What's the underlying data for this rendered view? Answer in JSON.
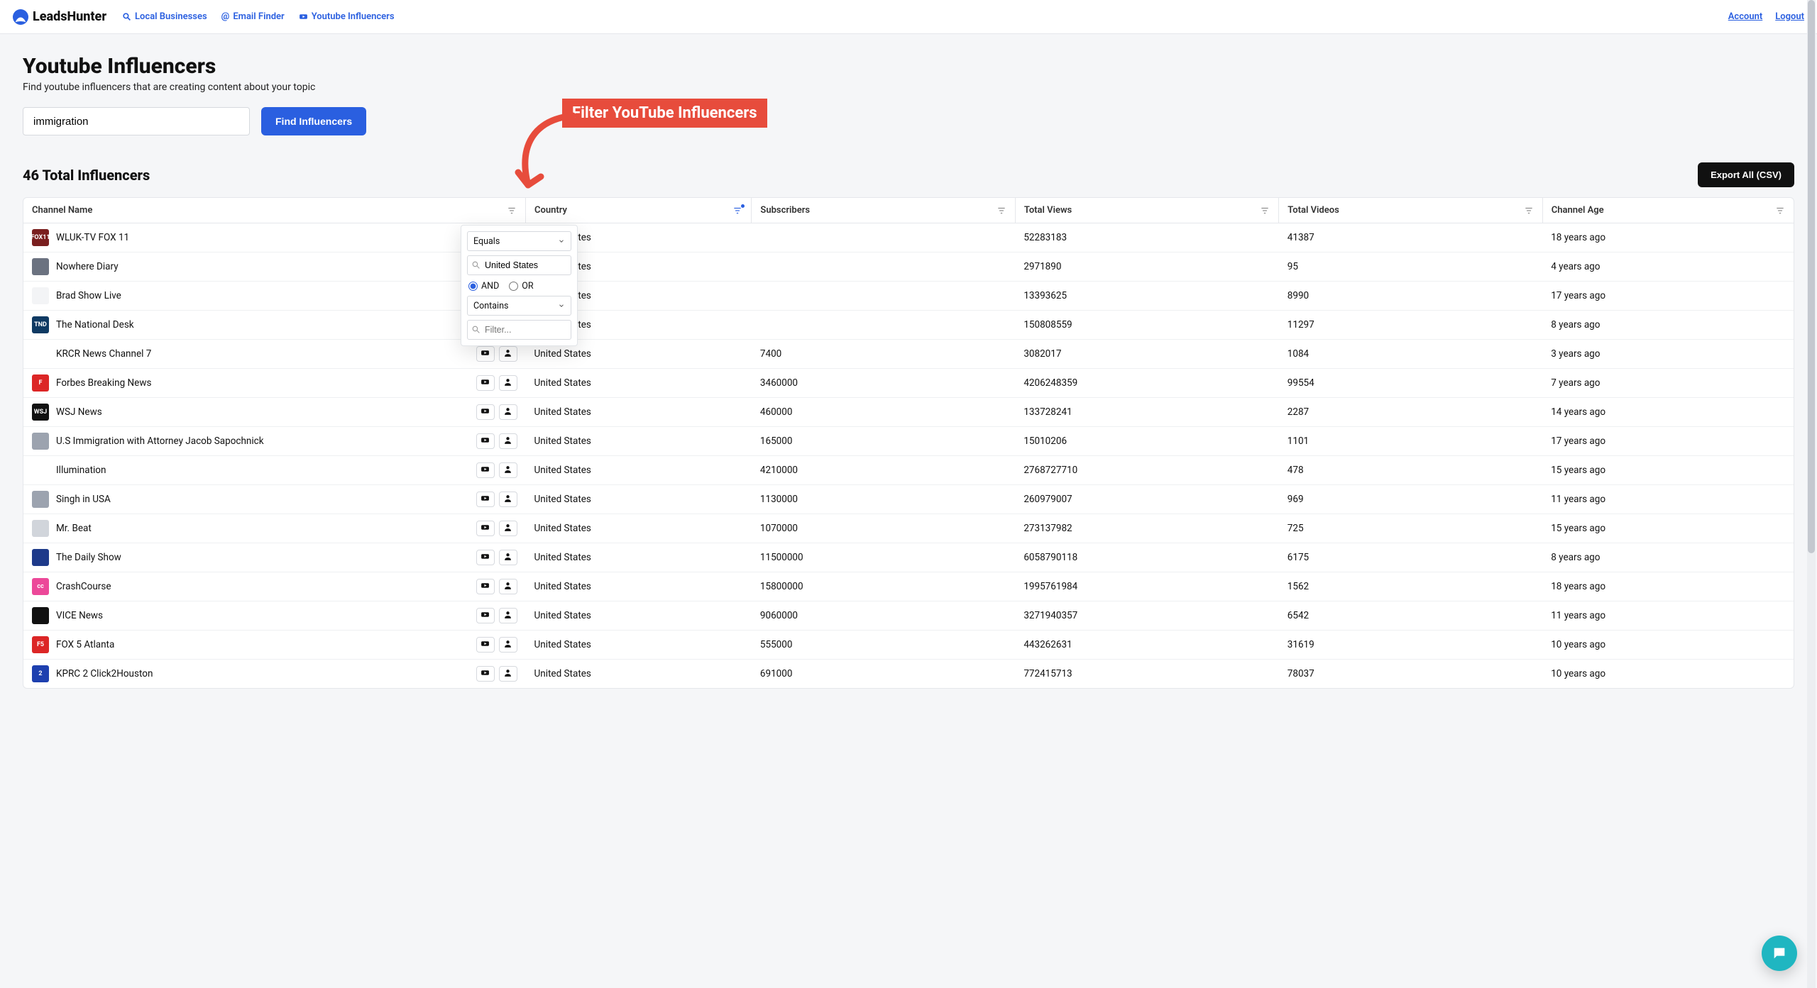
{
  "brand": "LeadsHunter",
  "nav": {
    "local": "Local Businesses",
    "email": "Email Finder",
    "youtube": "Youtube Influencers",
    "account": "Account",
    "logout": "Logout"
  },
  "page": {
    "title": "Youtube Influencers",
    "subtitle": "Find youtube influencers that are creating content about your topic"
  },
  "search": {
    "value": "immigration",
    "button": "Find Influencers"
  },
  "callout": {
    "text": "Filter YouTube Influencers"
  },
  "results": {
    "total_label": "46 Total Influencers",
    "export_label": "Export All (CSV)"
  },
  "columns": {
    "name": "Channel Name",
    "country": "Country",
    "subs": "Subscribers",
    "views": "Total Views",
    "videos": "Total Videos",
    "age": "Channel Age"
  },
  "filter_popup": {
    "op1": "Equals",
    "value1": "United States",
    "and": "AND",
    "or": "OR",
    "op2": "Contains",
    "placeholder2": "Filter..."
  },
  "rows": [
    {
      "avatar_bg": "#7a1f1f",
      "avatar_text": "FOX11",
      "name": "WLUK-TV FOX 11",
      "country": "United States",
      "subs": "",
      "views": "52283183",
      "videos": "41387",
      "age": "18 years ago"
    },
    {
      "avatar_bg": "#6b7280",
      "avatar_text": "",
      "name": "Nowhere Diary",
      "country": "United States",
      "subs": "",
      "views": "2971890",
      "videos": "95",
      "age": "4 years ago"
    },
    {
      "avatar_bg": "#f3f4f6",
      "avatar_text": "",
      "name": "Brad Show Live",
      "country": "United States",
      "subs": "",
      "views": "13393625",
      "videos": "8990",
      "age": "17 years ago"
    },
    {
      "avatar_bg": "#0f3a63",
      "avatar_text": "TND",
      "name": "The National Desk",
      "country": "United States",
      "subs": "",
      "views": "150808559",
      "videos": "11297",
      "age": "8 years ago"
    },
    {
      "avatar_bg": "#ffffff",
      "avatar_text": "",
      "name": "KRCR News Channel 7",
      "country": "United States",
      "subs": "7400",
      "views": "3082017",
      "videos": "1084",
      "age": "3 years ago"
    },
    {
      "avatar_bg": "#dc2626",
      "avatar_text": "F",
      "name": "Forbes Breaking News",
      "country": "United States",
      "subs": "3460000",
      "views": "4206248359",
      "videos": "99554",
      "age": "7 years ago"
    },
    {
      "avatar_bg": "#111111",
      "avatar_text": "WSJ",
      "name": "WSJ News",
      "country": "United States",
      "subs": "460000",
      "views": "133728241",
      "videos": "2287",
      "age": "14 years ago"
    },
    {
      "avatar_bg": "#9ca3af",
      "avatar_text": "",
      "name": "U.S Immigration with Attorney Jacob Sapochnick",
      "country": "United States",
      "subs": "165000",
      "views": "15010206",
      "videos": "1101",
      "age": "17 years ago"
    },
    {
      "avatar_bg": "#ffffff",
      "avatar_text": "",
      "name": "Illumination",
      "country": "United States",
      "subs": "4210000",
      "views": "2768727710",
      "videos": "478",
      "age": "15 years ago"
    },
    {
      "avatar_bg": "#9ca3af",
      "avatar_text": "",
      "name": "Singh in USA",
      "country": "United States",
      "subs": "1130000",
      "views": "260979007",
      "videos": "969",
      "age": "11 years ago"
    },
    {
      "avatar_bg": "#d1d5db",
      "avatar_text": "",
      "name": "Mr. Beat",
      "country": "United States",
      "subs": "1070000",
      "views": "273137982",
      "videos": "725",
      "age": "15 years ago"
    },
    {
      "avatar_bg": "#1e3a8a",
      "avatar_text": "",
      "name": "The Daily Show",
      "country": "United States",
      "subs": "11500000",
      "views": "6058790118",
      "videos": "6175",
      "age": "8 years ago"
    },
    {
      "avatar_bg": "#ec4899",
      "avatar_text": "cc",
      "name": "CrashCourse",
      "country": "United States",
      "subs": "15800000",
      "views": "1995761984",
      "videos": "1562",
      "age": "18 years ago"
    },
    {
      "avatar_bg": "#111111",
      "avatar_text": "",
      "name": "VICE News",
      "country": "United States",
      "subs": "9060000",
      "views": "3271940357",
      "videos": "6542",
      "age": "11 years ago"
    },
    {
      "avatar_bg": "#dc2626",
      "avatar_text": "F5",
      "name": "FOX 5 Atlanta",
      "country": "United States",
      "subs": "555000",
      "views": "443262631",
      "videos": "31619",
      "age": "10 years ago"
    },
    {
      "avatar_bg": "#1e40af",
      "avatar_text": "2",
      "name": "KPRC 2 Click2Houston",
      "country": "United States",
      "subs": "691000",
      "views": "772415713",
      "videos": "78037",
      "age": "10 years ago"
    }
  ]
}
